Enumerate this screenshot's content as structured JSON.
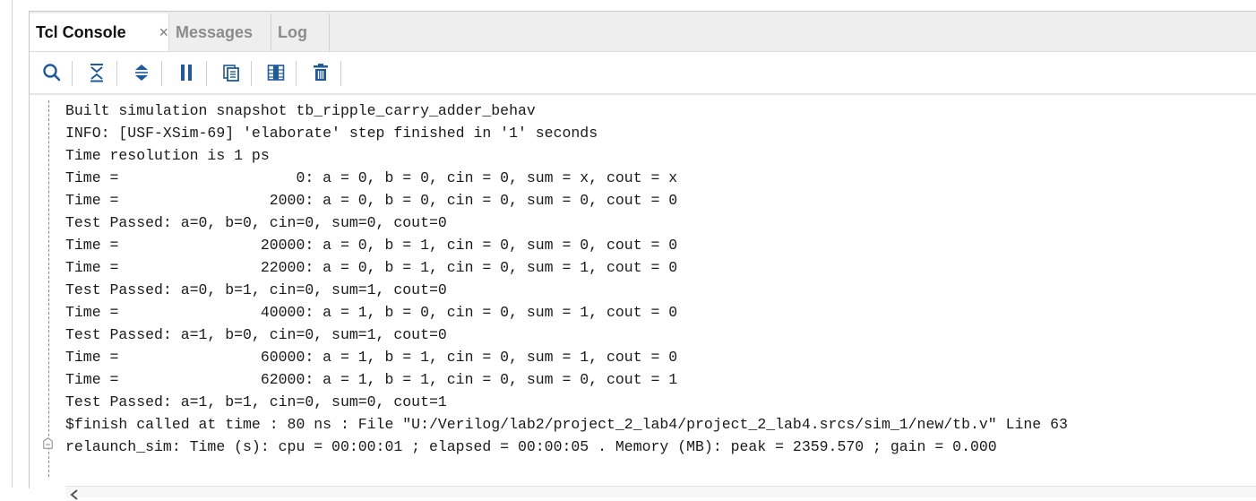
{
  "tabs": [
    {
      "label": "Tcl Console",
      "close": "×"
    },
    {
      "label": "Messages"
    },
    {
      "label": "Log"
    }
  ],
  "toolbar": {
    "icons": [
      "search-icon",
      "collapse-all-icon",
      "expand-all-icon",
      "pause-icon",
      "copy-icon",
      "columns-icon",
      "delete-icon"
    ]
  },
  "console": {
    "lines": [
      "Built simulation snapshot tb_ripple_carry_adder_behav",
      "INFO: [USF-XSim-69] 'elaborate' step finished in '1' seconds",
      "Time resolution is 1 ps",
      "Time =                    0: a = 0, b = 0, cin = 0, sum = x, cout = x",
      "Time =                 2000: a = 0, b = 0, cin = 0, sum = 0, cout = 0",
      "Test Passed: a=0, b=0, cin=0, sum=0, cout=0",
      "Time =                20000: a = 0, b = 1, cin = 0, sum = 0, cout = 0",
      "Time =                22000: a = 0, b = 1, cin = 0, sum = 1, cout = 0",
      "Test Passed: a=0, b=1, cin=0, sum=1, cout=0",
      "Time =                40000: a = 1, b = 0, cin = 0, sum = 1, cout = 0",
      "Test Passed: a=1, b=0, cin=0, sum=1, cout=0",
      "Time =                60000: a = 1, b = 1, cin = 0, sum = 1, cout = 0",
      "Time =                62000: a = 1, b = 1, cin = 0, sum = 0, cout = 1",
      "Test Passed: a=1, b=1, cin=0, sum=0, cout=1",
      "$finish called at time : 80 ns : File \"U:/Verilog/lab2/project_2_lab4/project_2_lab4.srcs/sim_1/new/tb.v\" Line 63",
      "relaunch_sim: Time (s): cpu = 00:00:01 ; elapsed = 00:00:05 . Memory (MB): peak = 2359.570 ; gain = 0.000"
    ]
  },
  "colors": {
    "tabbar_bg": "#eeeeee",
    "icon_blue": "#1f5a9e",
    "text": "#1a1a1a"
  }
}
